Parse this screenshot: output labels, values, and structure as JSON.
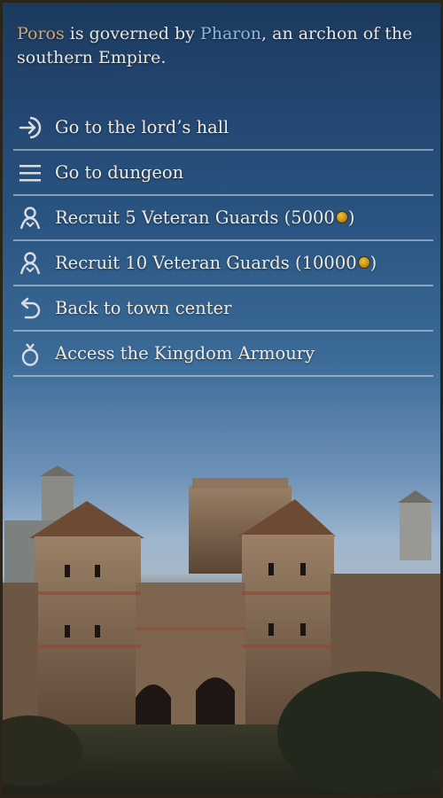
{
  "intro": {
    "settlement": "Poros",
    "text_1": " is governed by ",
    "lord": "Pharon",
    "text_2": ", an archon of the southern Empire."
  },
  "menu": {
    "items": [
      {
        "label": "Go to the lord’s hall",
        "icon": "enter-arrow-icon"
      },
      {
        "label": "Go to dungeon",
        "icon": "list-lines-icon"
      },
      {
        "label_pre": "Recruit 5 Veteran Guards (5000",
        "label_post": ")",
        "icon": "troop-icon",
        "currency": "gold-coin-icon"
      },
      {
        "label_pre": "Recruit 10 Veteran Guards (10000",
        "label_post": ")",
        "icon": "troop-icon",
        "currency": "gold-coin-icon"
      },
      {
        "label": "Back to town center",
        "icon": "return-arrow-icon"
      },
      {
        "label": "Access the Kingdom Armoury",
        "icon": "armoury-pouch-icon"
      }
    ]
  },
  "colors": {
    "settlement_highlight": "#d9a46a",
    "lord_highlight": "#8fb6d8",
    "text": "#efece4",
    "divider": "#d2dce6"
  }
}
